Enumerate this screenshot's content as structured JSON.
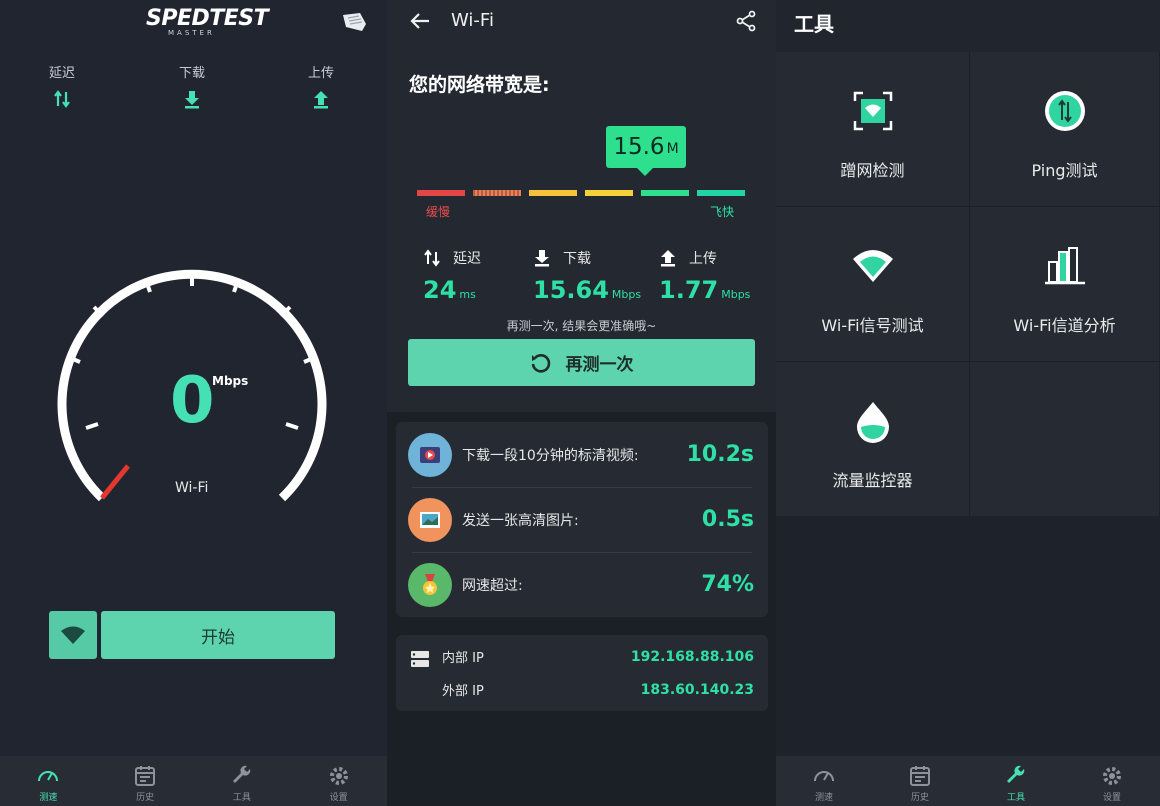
{
  "speedtest": {
    "logo": "SPEDTEST",
    "logo_sub": "MASTER",
    "metrics": {
      "latency": "延迟",
      "download": "下载",
      "upload": "上传"
    },
    "gauge_value": "0",
    "gauge_unit": "Mbps",
    "network": "Wi-Fi",
    "start_label": "开始"
  },
  "result": {
    "title": "Wi-Fi",
    "bandwidth_title": "您的网络带宽是:",
    "speed_value": "15.6",
    "speed_unit": "M",
    "scale_slow": "缓慢",
    "scale_fast": "飞快",
    "scale_colors": [
      "#e24646",
      "#ee7f58",
      "#f5c23c",
      "#f4d13a",
      "#2ee08e",
      "#22d3a3"
    ],
    "latency_label": "延迟",
    "latency_value": "24",
    "latency_unit": "ms",
    "download_label": "下载",
    "download_value": "15.64",
    "download_unit": "Mbps",
    "upload_label": "上传",
    "upload_value": "1.77",
    "upload_unit": "Mbps",
    "hint": "再测一次, 结果会更准确哦~",
    "retest_label": "再测一次",
    "items": [
      {
        "label": "下载一段10分钟的标清视频:",
        "value": "10.2s"
      },
      {
        "label": "发送一张高清图片:",
        "value": "0.5s"
      },
      {
        "label": "网速超过:",
        "value": "74%"
      }
    ],
    "ip": {
      "internal_label": "内部 IP",
      "internal_value": "192.168.88.106",
      "external_label": "外部 IP",
      "external_value": "183.60.140.23"
    }
  },
  "tools": {
    "title": "工具",
    "items": [
      "蹭网检测",
      "Ping测试",
      "Wi-Fi信号测试",
      "Wi-Fi信道分析",
      "流量监控器"
    ]
  },
  "tabs": [
    "测速",
    "历史",
    "工具",
    "设置"
  ],
  "colors": {
    "accent": "#45e0b4",
    "button": "#5ed4ae"
  }
}
